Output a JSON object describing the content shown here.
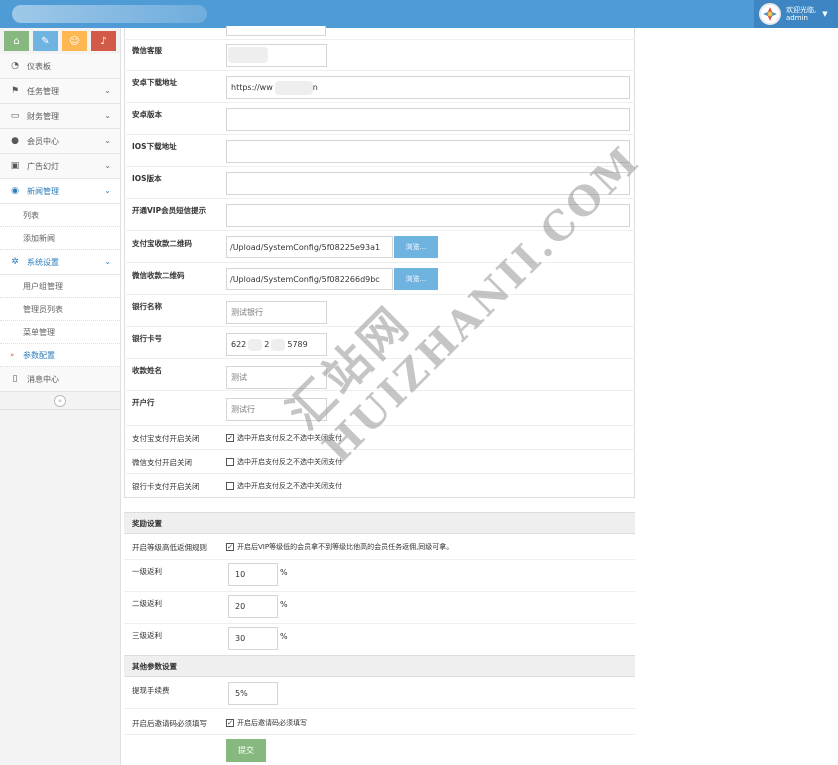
{
  "header": {
    "welcome": "欢迎光临,",
    "username": "admin"
  },
  "shortcuts": [
    {
      "icon": "home-icon",
      "glyph": "⌂"
    },
    {
      "icon": "pencil-icon",
      "glyph": "✎"
    },
    {
      "icon": "users-icon",
      "glyph": "☺"
    },
    {
      "icon": "bell-icon",
      "glyph": "♪"
    }
  ],
  "sidebar": {
    "dashboard": "仪表板",
    "tasks": "任务管理",
    "finance": "财务管理",
    "members": "会员中心",
    "ads": "广告幻灯",
    "news": "新闻管理",
    "news_list": "列表",
    "news_add": "添加新闻",
    "system": "系统设置",
    "sys_users": "用户组管理",
    "sys_admins": "管理员列表",
    "sys_menu": "菜单管理",
    "sys_params": "参数配置",
    "messages": "消息中心"
  },
  "form": {
    "wechat_service_label": "微信客服",
    "android_url_label": "安卓下载地址",
    "android_url_value": "https://ww",
    "android_url_tail": "n",
    "android_version_label": "安卓版本",
    "ios_url_label": "IOS下载地址",
    "ios_version_label": "IOS版本",
    "vip_sms_label": "开通VIP会员短信提示",
    "alipay_qr_label": "支付宝收款二维码",
    "alipay_qr_value": "/Upload/SystemConfig/5f08225e93a1",
    "browse_label": "浏览...",
    "wechat_qr_label": "微信收款二维码",
    "wechat_qr_value": "/Upload/SystemConfig/5f082266d9bc",
    "bank_name_label": "银行名称",
    "bank_name_value": "测试银行",
    "bank_card_label": "银行卡号",
    "bank_card_head": "622",
    "bank_card_mid": "2",
    "bank_card_tail": "5789",
    "payee_label": "收款姓名",
    "payee_value": "测试",
    "branch_label": "开户行",
    "branch_value": "测试行",
    "alipay_switch_label": "支付宝支付开启关闭",
    "alipay_switch_text": "选中开启支付反之不选中关闭支付",
    "wechat_switch_label": "微信支付开启关闭",
    "wechat_switch_text": "选中开启支付反之不选中关闭支付",
    "bank_switch_label": "银行卡支付开启关闭",
    "bank_switch_text": "选中开启支付反之不选中关闭支付"
  },
  "reward": {
    "section_title": "奖励设置",
    "level_rule_label": "开启等级高低返佣规则",
    "level_rule_text": "开启后VIP等级低的会员拿不到等级比他高的会员任务返佣,同级可拿。",
    "level1_label": "一级返利",
    "level1_value": "10",
    "level2_label": "二级返利",
    "level2_value": "20",
    "level3_label": "三级返利",
    "level3_value": "30",
    "pct": "%"
  },
  "other": {
    "section_title": "其他参数设置",
    "fee_label": "提现手续费",
    "fee_value": "5%",
    "invite_label": "开启后邀请码必须填写",
    "invite_text": "开启后邀请码必须填写",
    "submit_label": "提交"
  },
  "checkbox_states": {
    "alipay": true,
    "wechat": false,
    "bank": false,
    "level_rule": true,
    "invite": true
  },
  "watermark": {
    "line1": "汇站网",
    "line2": "HUIZHANII.COM"
  }
}
